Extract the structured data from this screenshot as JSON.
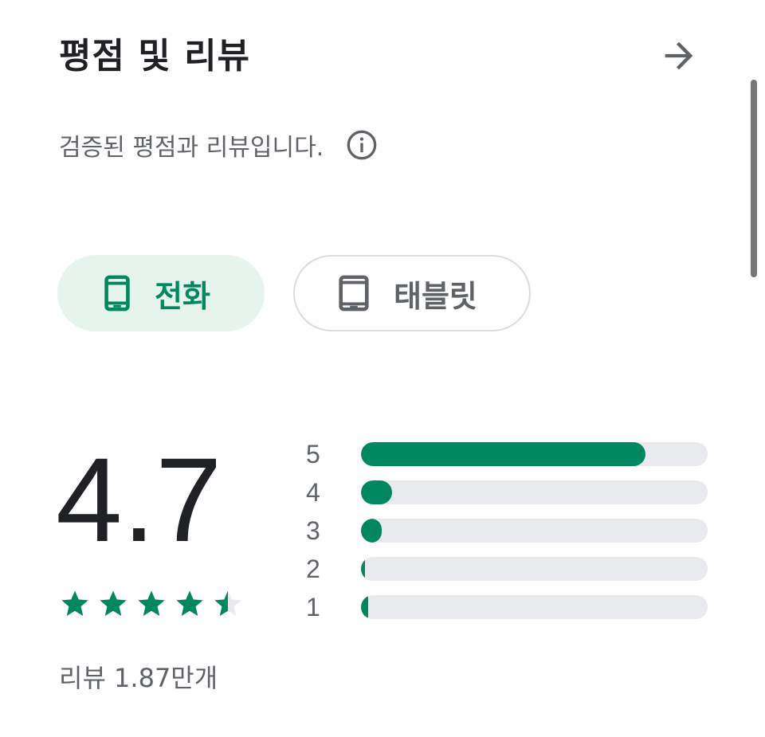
{
  "header": {
    "title": "평점 및 리뷰",
    "arrow_icon": "arrow-right-icon"
  },
  "subtitle": {
    "text": "검증된 평점과 리뷰입니다.",
    "icon": "info-icon"
  },
  "device_tabs": [
    {
      "label": "전화",
      "icon": "phone-icon",
      "selected": true
    },
    {
      "label": "태블릿",
      "icon": "tablet-icon",
      "selected": false
    }
  ],
  "rating": {
    "score": "4.7",
    "stars": 4.5,
    "review_count": "리뷰 1.87만개"
  },
  "histogram": [
    {
      "label": "5",
      "fraction": 0.82
    },
    {
      "label": "4",
      "fraction": 0.09
    },
    {
      "label": "3",
      "fraction": 0.06
    },
    {
      "label": "2",
      "fraction": 0.01
    },
    {
      "label": "1",
      "fraction": 0.02
    }
  ],
  "colors": {
    "accent": "#01875f",
    "accent_bg": "#e6f4ee",
    "track": "#e8eaed",
    "text_secondary": "#5f6368"
  }
}
